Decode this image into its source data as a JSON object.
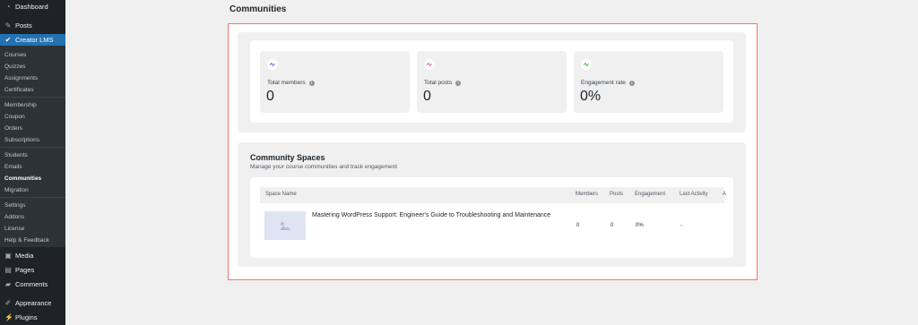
{
  "sidebar": {
    "top_items": [
      {
        "label": "Dashboard",
        "icon": "dashboard-icon"
      },
      {
        "label": "Posts",
        "icon": "pin-icon"
      },
      {
        "label": "Creator LMS",
        "icon": "creator-lms-icon"
      }
    ],
    "sub_items": {
      "group1": [
        "Courses",
        "Quizzes",
        "Assignments",
        "Certificates"
      ],
      "group2": [
        "Membership",
        "Coupon",
        "Orders",
        "Subscriptions"
      ],
      "group3": [
        "Students",
        "Emails",
        "Communities",
        "Migration"
      ],
      "group4": [
        "Settings",
        "Addons",
        "License",
        "Help & Feedback"
      ]
    },
    "bottom_items": [
      {
        "label": "Media",
        "icon": "media-icon"
      },
      {
        "label": "Pages",
        "icon": "pages-icon"
      },
      {
        "label": "Comments",
        "icon": "comments-icon"
      },
      {
        "label": "Appearance",
        "icon": "appearance-icon"
      },
      {
        "label": "Plugins",
        "icon": "plugins-icon"
      }
    ]
  },
  "page": {
    "title": "Communities"
  },
  "stats": [
    {
      "label": "Total members",
      "value": "0",
      "color": "#7c5cd6"
    },
    {
      "label": "Total posts",
      "value": "0",
      "color": "#e25a6f"
    },
    {
      "label": "Engagement rate",
      "value": "0%",
      "color": "#3bb54a"
    }
  ],
  "spaces": {
    "title": "Community Spaces",
    "subtitle": "Manage your course communities and track engagement",
    "columns": [
      "Space Name",
      "Members",
      "Posts",
      "Engagement",
      "Last Activity",
      "A"
    ],
    "rows": [
      {
        "name": "Mastering WordPress Support: Engineer's Guide to Troubleshooting and Maintenance",
        "members": "0",
        "posts": "0",
        "engagement": "0%",
        "last_activity": "-"
      }
    ]
  },
  "colors": {
    "accent": "#2271b1",
    "highlight": "#f2766a",
    "sidebar": "#1d2327"
  }
}
